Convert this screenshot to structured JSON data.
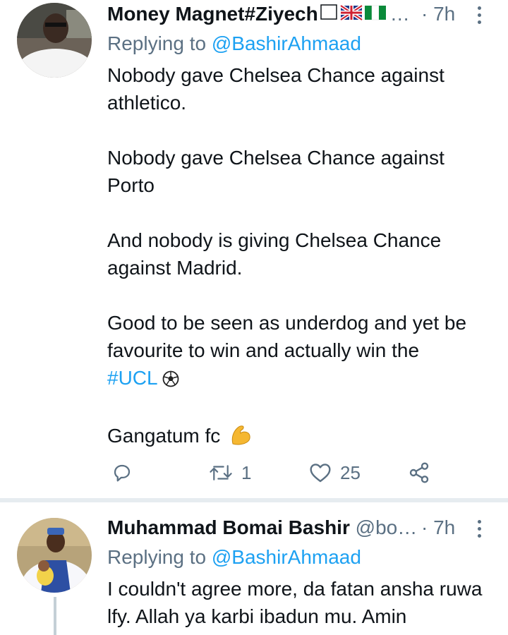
{
  "tweets": [
    {
      "author_name": "Money Magnet#Ziyech",
      "author_suffix": "…",
      "time": "· 7h",
      "replying_prefix": "Replying to",
      "replying_to": "@BashirAhmaad",
      "paragraphs": [
        "Nobody gave Chelsea Chance against athletico.",
        "Nobody gave Chelsea Chance against Porto",
        "And nobody is giving Chelsea Chance against Madrid.",
        "Good to be seen as underdog and yet be favourite to win and actually win the",
        "Gangatum fc"
      ],
      "hashtag": "#UCL",
      "retweets": "1",
      "likes": "25"
    },
    {
      "author_name": "Muhammad Bomai Bashir",
      "author_handle": "@bo…",
      "time": "· 7h",
      "replying_prefix": "Replying to",
      "replying_to": "@BashirAhmaad",
      "text": "I couldn't agree more, da fatan ansha ruwa lfy. Allah ya karbi ibadun mu. Amin"
    }
  ],
  "icons": [
    "reply-icon",
    "retweet-icon",
    "like-icon",
    "share-icon",
    "more-icon",
    "soccer-ball-icon",
    "flexed-biceps-icon",
    "uk-flag-icon",
    "nigeria-flag-icon"
  ],
  "colors": {
    "link": "#1da1f2",
    "secondary": "#5b7083",
    "divider": "#e6ecf0",
    "thread_line": "#c4cfd6"
  }
}
